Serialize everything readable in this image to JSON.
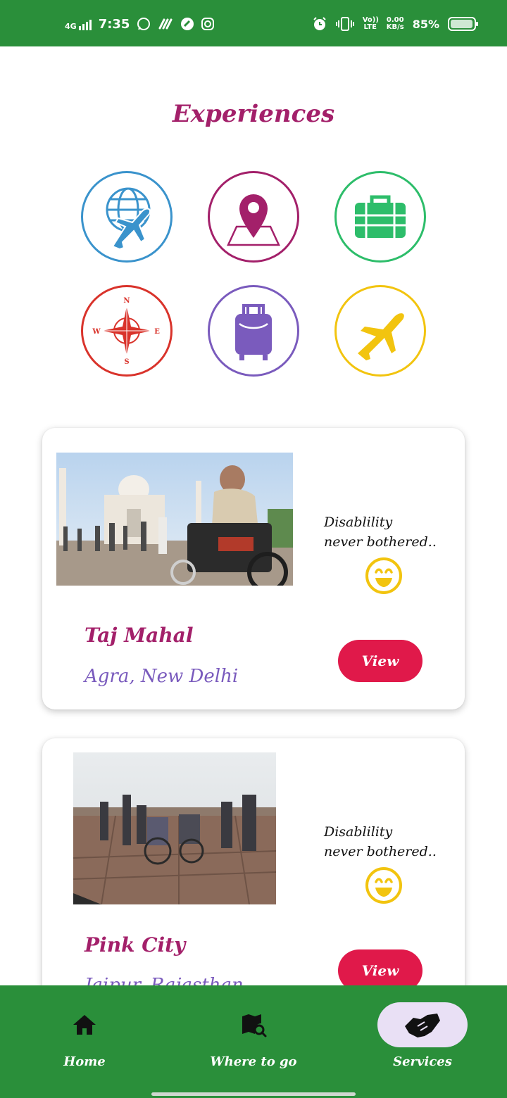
{
  "status_bar": {
    "network": "4G",
    "time": "7:35",
    "volte": "Vo)) LTE",
    "speed_value": "0.00",
    "speed_unit": "KB/s",
    "battery": "85%",
    "icons": [
      "whatsapp-icon",
      "app-icon",
      "app-icon",
      "instagram-icon",
      "alarm-icon",
      "vibrate-icon",
      "battery-icon"
    ]
  },
  "page": {
    "title": "Experiences"
  },
  "categories": [
    {
      "icon": "globe-plane-icon",
      "color": "#3a93cc"
    },
    {
      "icon": "map-pin-icon",
      "color": "#a3206a"
    },
    {
      "icon": "briefcase-icon",
      "color": "#2dbd6a"
    },
    {
      "icon": "compass-icon",
      "color": "#d9332b"
    },
    {
      "icon": "luggage-icon",
      "color": "#7a5bbd"
    },
    {
      "icon": "airplane-icon",
      "color": "#f2c40f"
    }
  ],
  "compass_letters": {
    "n": "N",
    "s": "S",
    "e": "E",
    "w": "W"
  },
  "cards": [
    {
      "tagline_line1": "Disablility",
      "tagline_line2": "never bothered..",
      "name": "Taj Mahal",
      "location": "Agra, New Delhi",
      "button": "View"
    },
    {
      "tagline_line1": "Disablility",
      "tagline_line2": "never bothered..",
      "name": "Pink City",
      "location": "Jaipur, Rajasthan",
      "button": "View"
    }
  ],
  "nav": {
    "items": [
      {
        "label": "Home",
        "icon": "home-icon"
      },
      {
        "label": "Where to go",
        "icon": "map-search-icon"
      },
      {
        "label": "Services",
        "icon": "handshake-icon",
        "active": true
      }
    ]
  },
  "colors": {
    "green": "#2a8f3a",
    "title": "#a3206a",
    "location": "#7a5bbd",
    "button": "#e0194a",
    "active_pill": "#e9e0f5"
  }
}
